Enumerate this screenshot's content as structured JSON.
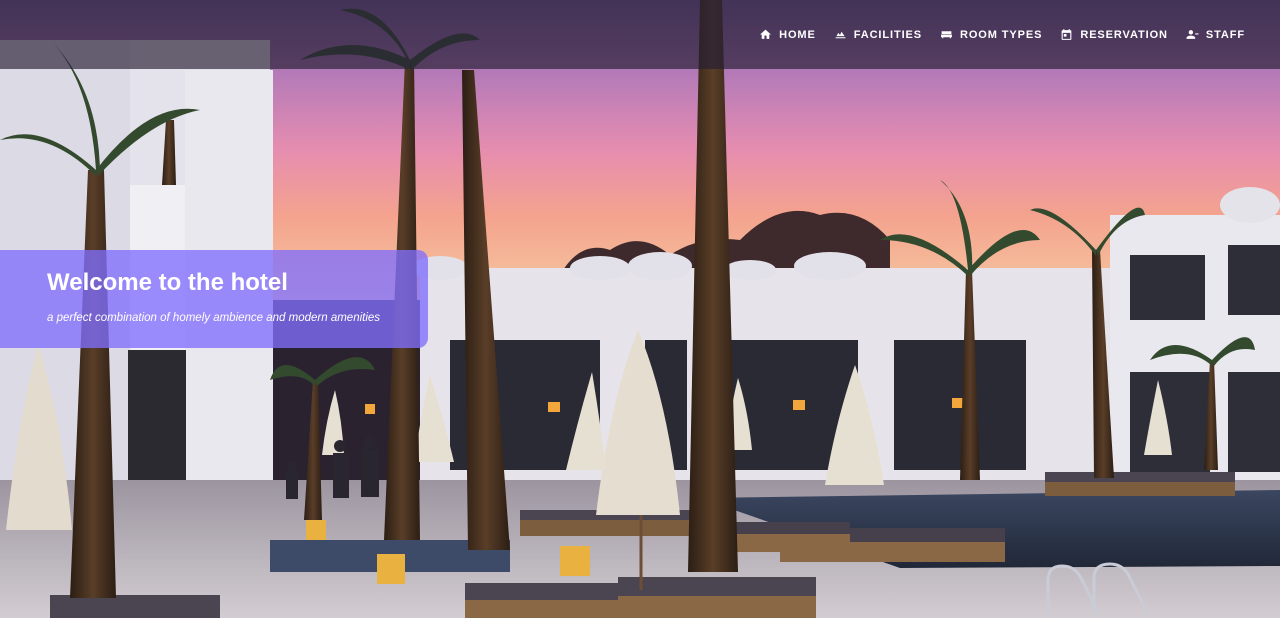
{
  "nav": {
    "items": [
      {
        "label": "HOME",
        "icon": "home-icon"
      },
      {
        "label": "FACILITIES",
        "icon": "facilities-icon"
      },
      {
        "label": "ROOM TYPES",
        "icon": "bed-icon"
      },
      {
        "label": "RESERVATION",
        "icon": "calendar-icon"
      },
      {
        "label": "STAFF",
        "icon": "staff-icon"
      }
    ]
  },
  "hero": {
    "title": "Welcome to the hotel",
    "subtitle": "a perfect combination of homely ambience and modern amenities"
  },
  "colors": {
    "navbar_bg": "#261e34",
    "welcome_bg": "#806efc",
    "nav_text": "#ffffff"
  }
}
